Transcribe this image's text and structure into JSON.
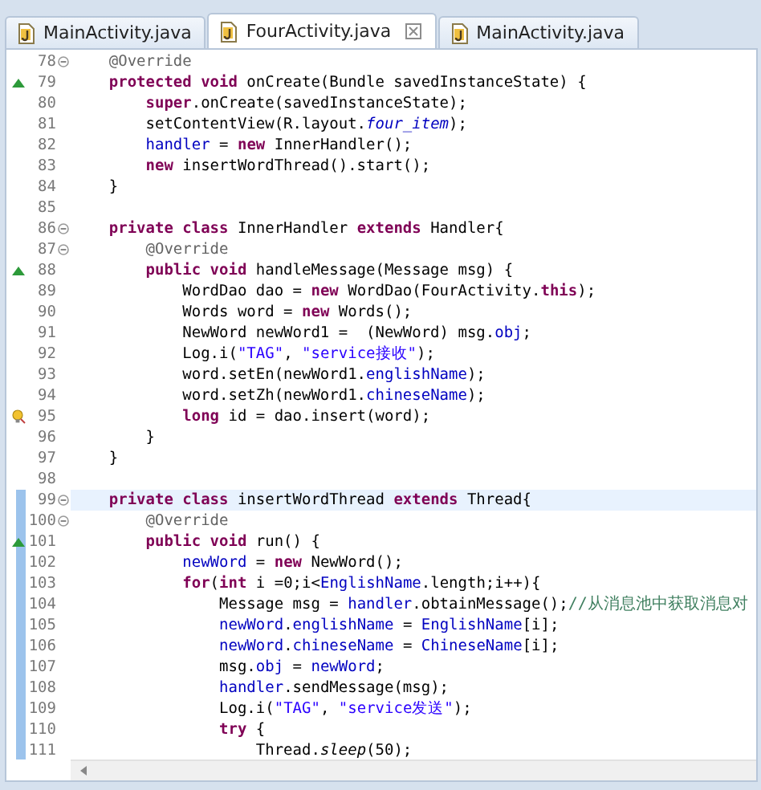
{
  "tabs": [
    {
      "label": "MainActivity.java",
      "selected": false
    },
    {
      "label": "FourActivity.java",
      "selected": true
    },
    {
      "label": "MainActivity.java",
      "selected": false
    }
  ],
  "editor": {
    "lines": [
      {
        "number": "78",
        "fold": true,
        "changed": false,
        "current": false,
        "tokens": [
          {
            "kind": "annotation",
            "text": "    @Override"
          }
        ]
      },
      {
        "number": "79",
        "kind": "override",
        "fold": false,
        "changed": false,
        "current": false,
        "tokens": [
          {
            "kind": "kw",
            "text": "    protected void"
          },
          {
            "kind": "plain",
            "text": " onCreate(Bundle savedInstanceState) {"
          }
        ]
      },
      {
        "number": "80",
        "fold": false,
        "changed": false,
        "current": false,
        "tokens": [
          {
            "kind": "kw",
            "text": "        super"
          },
          {
            "kind": "plain",
            "text": ".onCreate(savedInstanceState);"
          }
        ]
      },
      {
        "number": "81",
        "fold": false,
        "changed": false,
        "current": false,
        "tokens": [
          {
            "kind": "plain",
            "text": "        setContentView(R.layout."
          },
          {
            "kind": "static_field",
            "text": "four_item"
          },
          {
            "kind": "plain",
            "text": ");"
          }
        ]
      },
      {
        "number": "82",
        "fold": false,
        "changed": false,
        "current": false,
        "tokens": [
          {
            "kind": "field",
            "text": "        handler"
          },
          {
            "kind": "plain",
            "text": " = "
          },
          {
            "kind": "kw",
            "text": "new"
          },
          {
            "kind": "plain",
            "text": " InnerHandler();"
          }
        ]
      },
      {
        "number": "83",
        "fold": false,
        "changed": false,
        "current": false,
        "tokens": [
          {
            "kind": "kw",
            "text": "        new"
          },
          {
            "kind": "plain",
            "text": " insertWordThread().start();"
          }
        ]
      },
      {
        "number": "84",
        "fold": false,
        "changed": false,
        "current": false,
        "tokens": [
          {
            "kind": "plain",
            "text": "    }"
          }
        ]
      },
      {
        "number": "85",
        "fold": false,
        "changed": false,
        "current": false
      },
      {
        "number": "86",
        "fold": true,
        "changed": false,
        "current": false,
        "tokens": [
          {
            "kind": "kw",
            "text": "    private class"
          },
          {
            "kind": "plain",
            "text": " InnerHandler "
          },
          {
            "kind": "kw",
            "text": "extends"
          },
          {
            "kind": "plain",
            "text": " Handler{"
          }
        ]
      },
      {
        "number": "87",
        "fold": true,
        "changed": false,
        "current": false,
        "tokens": [
          {
            "kind": "annotation",
            "text": "        @Override"
          }
        ]
      },
      {
        "number": "88",
        "kind": "override",
        "fold": false,
        "changed": false,
        "current": false,
        "tokens": [
          {
            "kind": "kw",
            "text": "        public void"
          },
          {
            "kind": "plain",
            "text": " handleMessage(Message msg) {"
          }
        ]
      },
      {
        "number": "89",
        "fold": false,
        "changed": false,
        "current": false,
        "tokens": [
          {
            "kind": "plain",
            "text": "            WordDao dao = "
          },
          {
            "kind": "kw",
            "text": "new"
          },
          {
            "kind": "plain",
            "text": " WordDao(FourActivity."
          },
          {
            "kind": "kw",
            "text": "this"
          },
          {
            "kind": "plain",
            "text": ");"
          }
        ]
      },
      {
        "number": "90",
        "fold": false,
        "changed": false,
        "current": false,
        "tokens": [
          {
            "kind": "plain",
            "text": "            Words word = "
          },
          {
            "kind": "kw",
            "text": "new"
          },
          {
            "kind": "plain",
            "text": " Words();"
          }
        ]
      },
      {
        "number": "91",
        "fold": false,
        "changed": false,
        "current": false,
        "tokens": [
          {
            "kind": "plain",
            "text": "            NewWord newWord1 =  (NewWord) msg."
          },
          {
            "kind": "field",
            "text": "obj"
          },
          {
            "kind": "plain",
            "text": ";"
          }
        ]
      },
      {
        "number": "92",
        "fold": false,
        "changed": false,
        "current": false,
        "tokens": [
          {
            "kind": "plain",
            "text": "            Log.i("
          },
          {
            "kind": "string",
            "text": "\"TAG\""
          },
          {
            "kind": "plain",
            "text": ", "
          },
          {
            "kind": "string",
            "text": "\"service接收\""
          },
          {
            "kind": "plain",
            "text": ");"
          }
        ]
      },
      {
        "number": "93",
        "fold": false,
        "changed": false,
        "current": false,
        "tokens": [
          {
            "kind": "plain",
            "text": "            word.setEn(newWord1."
          },
          {
            "kind": "field",
            "text": "englishName"
          },
          {
            "kind": "plain",
            "text": ");"
          }
        ]
      },
      {
        "number": "94",
        "fold": false,
        "changed": false,
        "current": false,
        "tokens": [
          {
            "kind": "plain",
            "text": "            word.setZh(newWord1."
          },
          {
            "kind": "field",
            "text": "chineseName"
          },
          {
            "kind": "plain",
            "text": ");"
          }
        ]
      },
      {
        "number": "95",
        "kind": "warning",
        "fold": false,
        "changed": false,
        "current": false,
        "tokens": [
          {
            "kind": "kw",
            "text": "            long"
          },
          {
            "kind": "plain",
            "text": " id = dao.insert(word);"
          }
        ]
      },
      {
        "number": "96",
        "fold": false,
        "changed": false,
        "current": false,
        "tokens": [
          {
            "kind": "plain",
            "text": "        }"
          }
        ]
      },
      {
        "number": "97",
        "fold": false,
        "changed": false,
        "current": false,
        "tokens": [
          {
            "kind": "plain",
            "text": "    }"
          }
        ]
      },
      {
        "number": "98",
        "fold": false,
        "changed": false,
        "current": false
      },
      {
        "number": "99",
        "fold": true,
        "changed": true,
        "current": true,
        "tokens": [
          {
            "kind": "kw",
            "text": "    private class"
          },
          {
            "kind": "plain",
            "text": " insertWordThread "
          },
          {
            "kind": "kw",
            "text": "extends"
          },
          {
            "kind": "plain",
            "text": " Thread{"
          }
        ]
      },
      {
        "number": "100",
        "fold": true,
        "changed": true,
        "current": false,
        "tokens": [
          {
            "kind": "annotation",
            "text": "        @Override"
          }
        ]
      },
      {
        "number": "101",
        "kind": "override",
        "fold": false,
        "changed": true,
        "current": false,
        "tokens": [
          {
            "kind": "kw",
            "text": "        public void"
          },
          {
            "kind": "plain",
            "text": " run() {"
          }
        ]
      },
      {
        "number": "102",
        "fold": false,
        "changed": true,
        "current": false,
        "tokens": [
          {
            "kind": "field",
            "text": "            newWord"
          },
          {
            "kind": "plain",
            "text": " = "
          },
          {
            "kind": "kw",
            "text": "new"
          },
          {
            "kind": "plain",
            "text": " NewWord();"
          }
        ]
      },
      {
        "number": "103",
        "fold": false,
        "changed": true,
        "current": false,
        "tokens": [
          {
            "kind": "kw",
            "text": "            for"
          },
          {
            "kind": "plain",
            "text": "("
          },
          {
            "kind": "kw",
            "text": "int"
          },
          {
            "kind": "plain",
            "text": " i =0;i<"
          },
          {
            "kind": "field",
            "text": "EnglishName"
          },
          {
            "kind": "plain",
            "text": ".length;i++){"
          }
        ]
      },
      {
        "number": "104",
        "fold": false,
        "changed": true,
        "current": false,
        "tokens": [
          {
            "kind": "plain",
            "text": "                Message msg = "
          },
          {
            "kind": "field",
            "text": "handler"
          },
          {
            "kind": "plain",
            "text": ".obtainMessage();"
          },
          {
            "kind": "comment",
            "text": "//从消息池中获取消息对"
          }
        ]
      },
      {
        "number": "105",
        "fold": false,
        "changed": true,
        "current": false,
        "tokens": [
          {
            "kind": "field",
            "text": "                newWord"
          },
          {
            "kind": "plain",
            "text": "."
          },
          {
            "kind": "field",
            "text": "englishName"
          },
          {
            "kind": "plain",
            "text": " = "
          },
          {
            "kind": "field",
            "text": "EnglishName"
          },
          {
            "kind": "plain",
            "text": "[i];"
          }
        ]
      },
      {
        "number": "106",
        "fold": false,
        "changed": true,
        "current": false,
        "tokens": [
          {
            "kind": "field",
            "text": "                newWord"
          },
          {
            "kind": "plain",
            "text": "."
          },
          {
            "kind": "field",
            "text": "chineseName"
          },
          {
            "kind": "plain",
            "text": " = "
          },
          {
            "kind": "field",
            "text": "ChineseName"
          },
          {
            "kind": "plain",
            "text": "[i];"
          }
        ]
      },
      {
        "number": "107",
        "fold": false,
        "changed": true,
        "current": false,
        "tokens": [
          {
            "kind": "plain",
            "text": "                msg."
          },
          {
            "kind": "field",
            "text": "obj"
          },
          {
            "kind": "plain",
            "text": " = "
          },
          {
            "kind": "field",
            "text": "newWord"
          },
          {
            "kind": "plain",
            "text": ";"
          }
        ]
      },
      {
        "number": "108",
        "fold": false,
        "changed": true,
        "current": false,
        "tokens": [
          {
            "kind": "field",
            "text": "                handler"
          },
          {
            "kind": "plain",
            "text": ".sendMessage(msg);"
          }
        ]
      },
      {
        "number": "109",
        "fold": false,
        "changed": true,
        "current": false,
        "tokens": [
          {
            "kind": "plain",
            "text": "                Log.i("
          },
          {
            "kind": "string",
            "text": "\"TAG\""
          },
          {
            "kind": "plain",
            "text": ", "
          },
          {
            "kind": "string",
            "text": "\"service发送\""
          },
          {
            "kind": "plain",
            "text": ");"
          }
        ]
      },
      {
        "number": "110",
        "fold": false,
        "changed": true,
        "current": false,
        "tokens": [
          {
            "kind": "kw",
            "text": "                try"
          },
          {
            "kind": "plain",
            "text": " {"
          }
        ]
      },
      {
        "number": "111",
        "fold": false,
        "changed": true,
        "current": false,
        "tokens": [
          {
            "kind": "plain",
            "text": "                    Thread."
          },
          {
            "kind": "static_method",
            "text": "sleep"
          },
          {
            "kind": "plain",
            "text": "(50);"
          }
        ]
      }
    ]
  }
}
